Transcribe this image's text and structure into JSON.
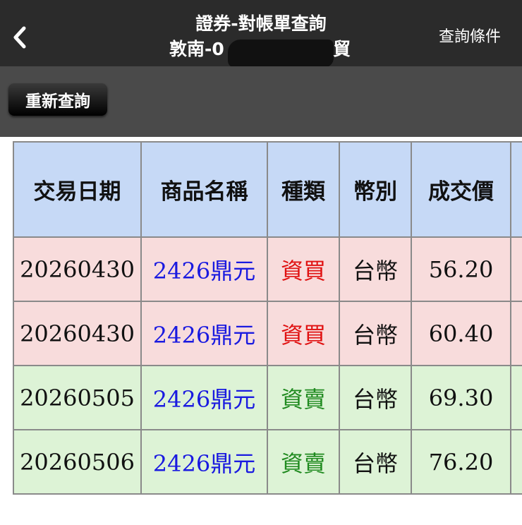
{
  "header": {
    "title": "證券-對帳單查詢",
    "subtitle_prefix": "敦南-0",
    "subtitle_suffix": "貿",
    "right_action": "查詢條件",
    "back_icon": "chevron-left-icon"
  },
  "toolbar": {
    "requery_label": "重新查詢"
  },
  "table": {
    "columns": [
      "交易日期",
      "商品名稱",
      "種類",
      "幣別",
      "成交價",
      ""
    ],
    "rows": [
      {
        "date": "20260430",
        "name": "2426鼎元",
        "type": "資買",
        "currency": "台幣",
        "price": "56.20"
      },
      {
        "date": "20260430",
        "name": "2426鼎元",
        "type": "資買",
        "currency": "台幣",
        "price": "60.40"
      },
      {
        "date": "20260505",
        "name": "2426鼎元",
        "type": "資賣",
        "currency": "台幣",
        "price": "69.30"
      },
      {
        "date": "20260506",
        "name": "2426鼎元",
        "type": "資賣",
        "currency": "台幣",
        "price": "76.20"
      }
    ]
  },
  "colors": {
    "header_bg": "#2b2b2b",
    "toolbar_bg": "#4a4a4a",
    "table_header_bg": "#c6d9f6",
    "buy_row_bg": "#f8dcdc",
    "sell_row_bg": "#ddf3d6",
    "buy_text": "#e01010",
    "sell_text": "#1f8a1f",
    "product_text": "#1a1ae0"
  }
}
